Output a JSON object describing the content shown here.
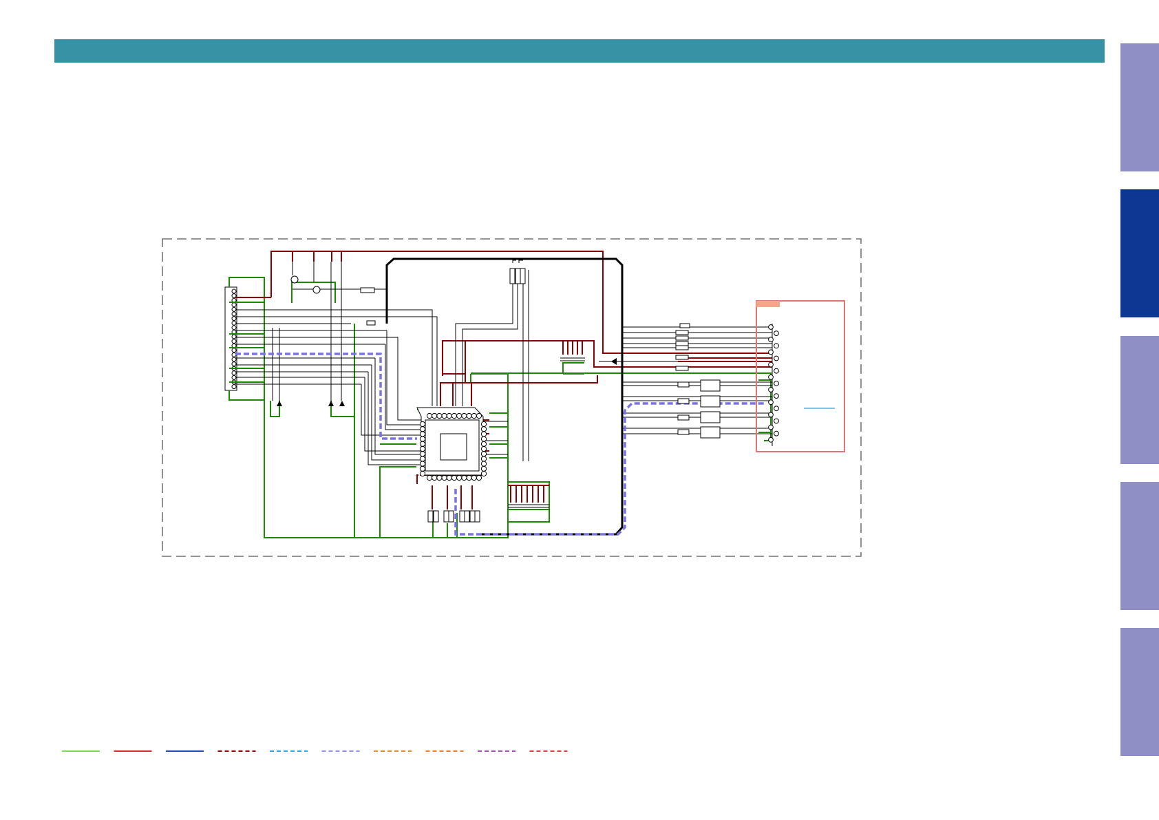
{
  "header": {
    "color": "#3792a6"
  },
  "side_tabs": [
    {
      "id": "tab-1",
      "color": "#8f8fc6",
      "active": false
    },
    {
      "id": "tab-2",
      "color": "#0e3693",
      "active": true
    },
    {
      "id": "tab-3",
      "color": "#8f8fc6",
      "active": false
    },
    {
      "id": "tab-4",
      "color": "#8f8fc6",
      "active": false
    },
    {
      "id": "tab-5",
      "color": "#8f8fc6",
      "active": false
    }
  ],
  "colors": {
    "wire": "#000000",
    "power": "#8b0000",
    "ground": "#1a8a00",
    "signal_dashed": "#7b74e0",
    "connector_box": "#e57373",
    "connector_label": "#f2a68a",
    "link_line": "#2a9fd6"
  },
  "legend": [
    {
      "style": "solid",
      "color": "#7ed957"
    },
    {
      "style": "solid",
      "color": "#d62b2b"
    },
    {
      "style": "solid",
      "color": "#1f48b8"
    },
    {
      "style": "dashed",
      "color": "#8b0000"
    },
    {
      "style": "dashed",
      "color": "#2aa7e0"
    },
    {
      "style": "dashed",
      "color": "#8f8fe8"
    },
    {
      "style": "dashed",
      "color": "#e08a2a"
    },
    {
      "style": "dashed",
      "color": "#f07a2a"
    },
    {
      "style": "dashed",
      "color": "#a04fb0"
    },
    {
      "style": "dashed",
      "color": "#e03c3c"
    }
  ]
}
